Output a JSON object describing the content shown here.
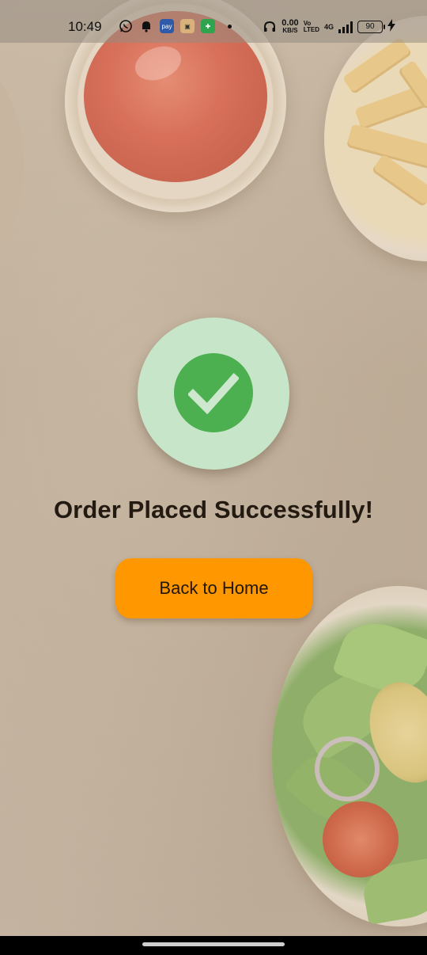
{
  "status_bar": {
    "time": "10:49",
    "net_speed_value": "0.00",
    "net_speed_unit": "KB/S",
    "volte_top": "Vo",
    "volte_bottom": "LTED",
    "network": "4G",
    "battery": "90",
    "icons": [
      "whatsapp-icon",
      "bell-icon",
      "app-icon-blue",
      "app-icon-box",
      "shield-icon",
      "headphones-icon",
      "signal-icon",
      "charging-icon"
    ]
  },
  "success": {
    "title": "Order Placed Successfully!",
    "button_label": "Back to Home"
  },
  "colors": {
    "accent": "#ff9800",
    "check_green": "#4caf50",
    "check_bg": "#c7e6c9"
  }
}
